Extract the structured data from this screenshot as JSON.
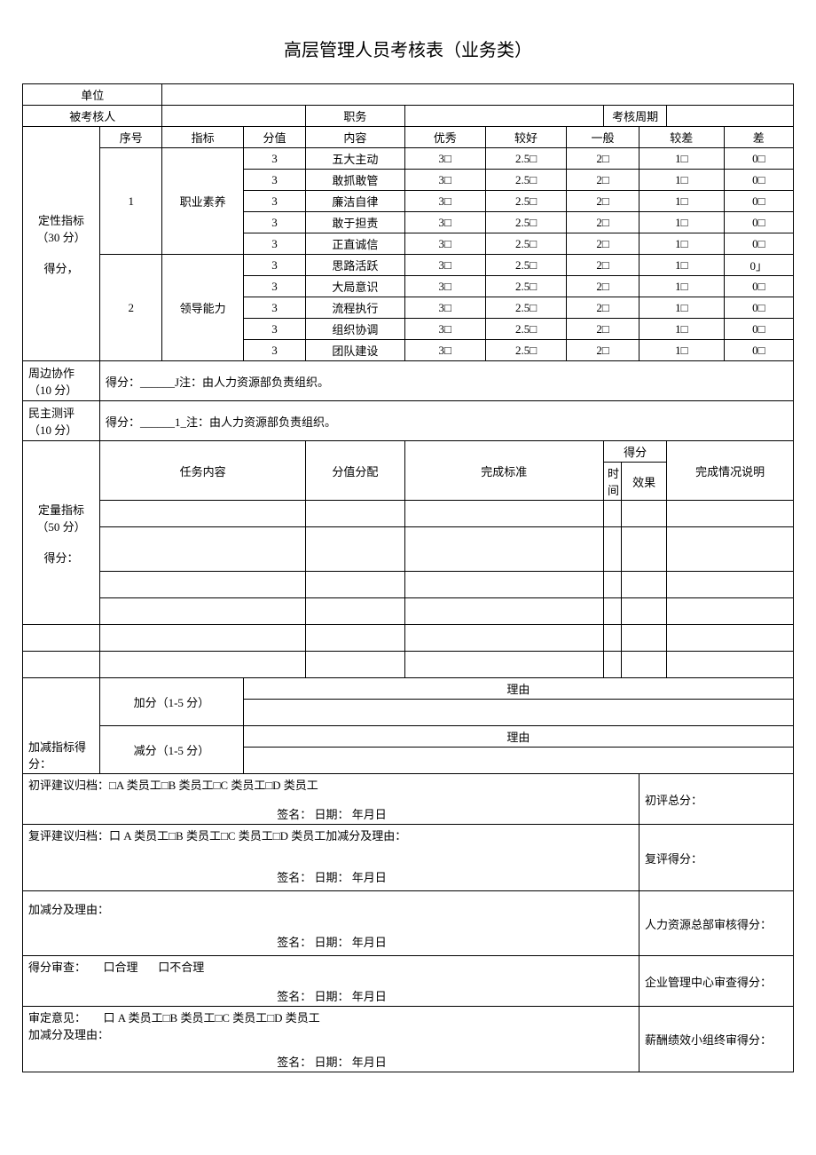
{
  "title": "高层管理人员考核表（业务类）",
  "header": {
    "unit_label": "单位",
    "appraisee_label": "被考核人",
    "position_label": "职务",
    "period_label": "考核周期"
  },
  "qual": {
    "section_label": "定性指标（30 分）\n\n得分，",
    "col_seq": "序号",
    "col_indicator": "指标",
    "col_score": "分值",
    "col_content": "内容",
    "col_excellent": "优秀",
    "col_good": "较好",
    "col_avg": "一般",
    "col_poor": "较差",
    "col_bad": "差",
    "groups": [
      {
        "seq": "1",
        "indicator": "职业素养",
        "rows": [
          {
            "score": "3",
            "content": "五大主动",
            "ex": "3□",
            "gd": "2.5□",
            "av": "2□",
            "pr": "1□",
            "bd": "0□"
          },
          {
            "score": "3",
            "content": "敢抓敢管",
            "ex": "3□",
            "gd": "2.5□",
            "av": "2□",
            "pr": "1□",
            "bd": "0□"
          },
          {
            "score": "3",
            "content": "廉洁自律",
            "ex": "3□",
            "gd": "2.5□",
            "av": "2□",
            "pr": "1□",
            "bd": "0□"
          },
          {
            "score": "3",
            "content": "敢于担责",
            "ex": "3□",
            "gd": "2.5□",
            "av": "2□",
            "pr": "1□",
            "bd": "0□"
          },
          {
            "score": "3",
            "content": "正直诚信",
            "ex": "3□",
            "gd": "2.5□",
            "av": "2□",
            "pr": "1□",
            "bd": "0□"
          }
        ]
      },
      {
        "seq": "2",
        "indicator": "领导能力",
        "rows": [
          {
            "score": "3",
            "content": "思路活跃",
            "ex": "3□",
            "gd": "2.5□",
            "av": "2□",
            "pr": "1□",
            "bd": "0」"
          },
          {
            "score": "3",
            "content": "大局意识",
            "ex": "3□",
            "gd": "2.5□",
            "av": "2□",
            "pr": "1□",
            "bd": "0□"
          },
          {
            "score": "3",
            "content": "流程执行",
            "ex": "3□",
            "gd": "2.5□",
            "av": "2□",
            "pr": "1□",
            "bd": "0□"
          },
          {
            "score": "3",
            "content": "组织协调",
            "ex": "3□",
            "gd": "2.5□",
            "av": "2□",
            "pr": "1□",
            "bd": "0□"
          },
          {
            "score": "3",
            "content": "团队建设",
            "ex": "3□",
            "gd": "2.5□",
            "av": "2□",
            "pr": "1□",
            "bd": "0□"
          }
        ]
      }
    ]
  },
  "peer": {
    "label": "周边协作（10 分）",
    "text": "得分：______J注：由人力资源部负责组织。"
  },
  "demo": {
    "label": "民主测评（10 分）",
    "text": "得分：______1_注：由人力资源部负责组织。"
  },
  "quant": {
    "section_label": "定量指标（50 分）\n\n得分：",
    "col_task": "任务内容",
    "col_alloc": "分值分配",
    "col_std": "完成标准",
    "col_score": "得分",
    "col_time": "时间",
    "col_effect": "效果",
    "col_desc": "完成情况说明"
  },
  "adj": {
    "section_label": "加减指标得分：",
    "add_label": "加分（1-5 分）",
    "sub_label": "减分（1-5 分）",
    "reason_label": "理由"
  },
  "sign": {
    "prelim": "初评建议归档：□A 类员工□B 类员工□C 类员工□D 类员工",
    "prelim_score": "初评总分：",
    "review": "复评建议归档：口 A 类员工□B 类员工□C 类员工□D 类员工加减分及理由：",
    "review_score": "复评得分：",
    "adj_reason": "加减分及理由：",
    "hr_score": "人力资源总部审核得分：",
    "score_check": "得分审查：      口合理       口不合理",
    "mgmt_score": "企业管理中心审查得分：",
    "final": "审定意见：      口 A 类员工□B 类员工□C 类员工□D 类员工",
    "final_sub": "加减分及理由：",
    "comp_score": "薪酬绩效小组终审得分：",
    "sign_line": "签名：                    日期：      年月日"
  }
}
